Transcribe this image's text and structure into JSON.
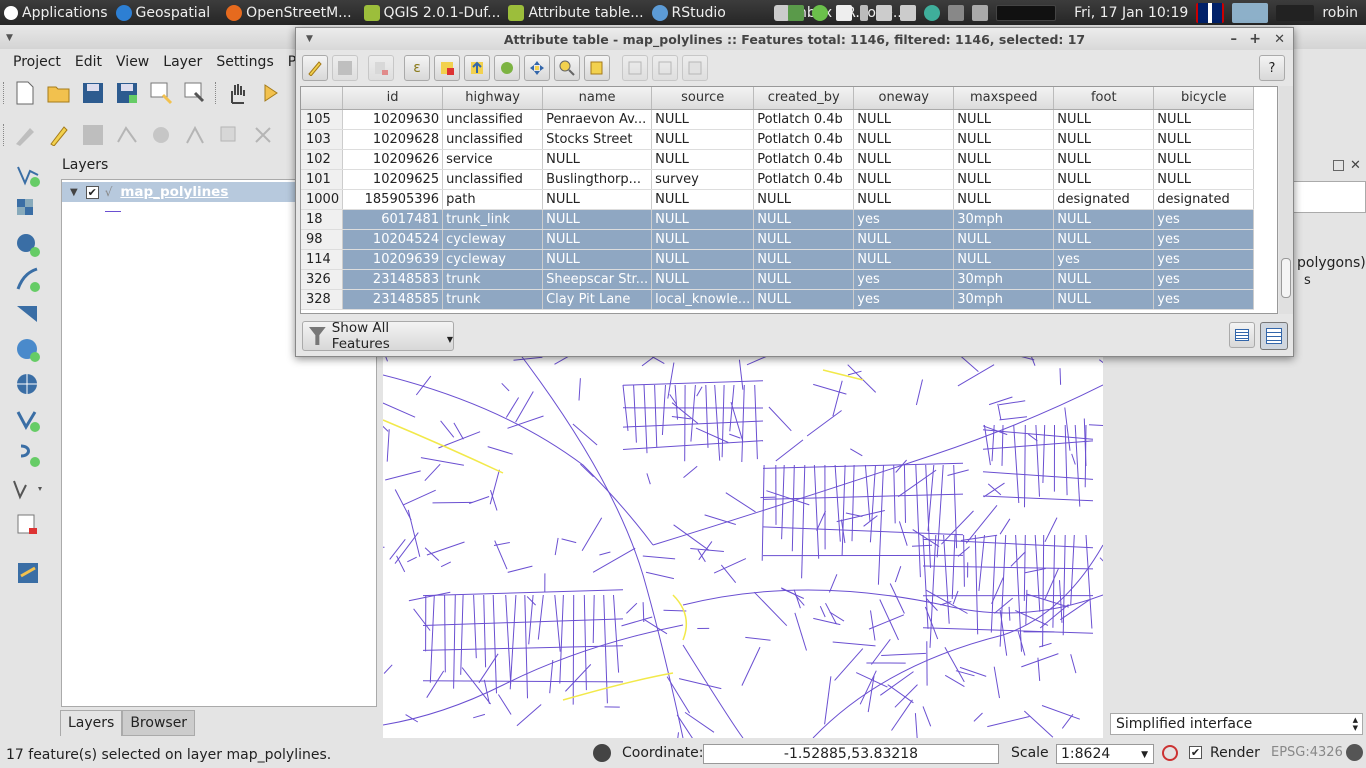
{
  "top_panel": {
    "applications": "Applications",
    "geospatial": "Geospatial",
    "tasks": [
      "OpenStreetM...",
      "QGIS 2.0.1-Duf...",
      "Attribute table...",
      "RStudio",
      "Inbox - R.Love..."
    ],
    "datetime": "Fri, 17 Jan  10:19",
    "user": "robin"
  },
  "menubar": {
    "items": [
      "Project",
      "Edit",
      "View",
      "Layer",
      "Settings",
      "Pl"
    ]
  },
  "layers_panel": {
    "title": "Layers",
    "layer_name": "map_polylines",
    "tabs": [
      "Layers",
      "Browser"
    ]
  },
  "right_panel": {
    "partial_text_1": "polygons)",
    "partial_text_2": "s",
    "interface_select": "Simplified interface"
  },
  "attribute_table": {
    "title": "Attribute table - map_polylines :: Features total: 1146, filtered: 1146, selected: 17",
    "columns": [
      "id",
      "highway",
      "name",
      "source",
      "created_by",
      "oneway",
      "maxspeed",
      "foot",
      "bicycle"
    ],
    "rows": [
      {
        "row": "105",
        "cells": [
          "10209630",
          "unclassified",
          "Penraevon Av...",
          "NULL",
          "Potlatch 0.4b",
          "NULL",
          "NULL",
          "NULL",
          "NULL"
        ],
        "selected": false
      },
      {
        "row": "103",
        "cells": [
          "10209628",
          "unclassified",
          "Stocks Street",
          "NULL",
          "Potlatch 0.4b",
          "NULL",
          "NULL",
          "NULL",
          "NULL"
        ],
        "selected": false
      },
      {
        "row": "102",
        "cells": [
          "10209626",
          "service",
          "NULL",
          "NULL",
          "Potlatch 0.4b",
          "NULL",
          "NULL",
          "NULL",
          "NULL"
        ],
        "selected": false
      },
      {
        "row": "101",
        "cells": [
          "10209625",
          "unclassified",
          "Buslingthorp...",
          "survey",
          "Potlatch 0.4b",
          "NULL",
          "NULL",
          "NULL",
          "NULL"
        ],
        "selected": false
      },
      {
        "row": "1000",
        "cells": [
          "185905396",
          "path",
          "NULL",
          "NULL",
          "NULL",
          "NULL",
          "NULL",
          "designated",
          "designated"
        ],
        "selected": false
      },
      {
        "row": "18",
        "cells": [
          "6017481",
          "trunk_link",
          "NULL",
          "NULL",
          "NULL",
          "yes",
          "30mph",
          "NULL",
          "yes"
        ],
        "selected": true
      },
      {
        "row": "98",
        "cells": [
          "10204524",
          "cycleway",
          "NULL",
          "NULL",
          "NULL",
          "NULL",
          "NULL",
          "NULL",
          "yes"
        ],
        "selected": true
      },
      {
        "row": "114",
        "cells": [
          "10209639",
          "cycleway",
          "NULL",
          "NULL",
          "NULL",
          "NULL",
          "NULL",
          "yes",
          "yes"
        ],
        "selected": true
      },
      {
        "row": "326",
        "cells": [
          "23148583",
          "trunk",
          "Sheepscar Str...",
          "NULL",
          "NULL",
          "yes",
          "30mph",
          "NULL",
          "yes"
        ],
        "selected": true
      },
      {
        "row": "328",
        "cells": [
          "23148585",
          "trunk",
          "Clay Pit Lane",
          "local_knowle...",
          "NULL",
          "yes",
          "30mph",
          "NULL",
          "yes"
        ],
        "selected": true
      }
    ],
    "filter_button": "Show All Features"
  },
  "statusbar": {
    "message": "17 feature(s) selected on layer map_polylines.",
    "coordinate_label": "Coordinate:",
    "coordinate_value": "-1.52885,53.83218",
    "scale_label": "Scale",
    "scale_value": "1:8624",
    "render_label": "Render",
    "crs": "EPSG:4326"
  },
  "colors": {
    "selection": "#8fa7c2",
    "roads": "#6a4fd1",
    "cycleways": "#f2e94a",
    "panel_dark": "#2e2e2e"
  }
}
